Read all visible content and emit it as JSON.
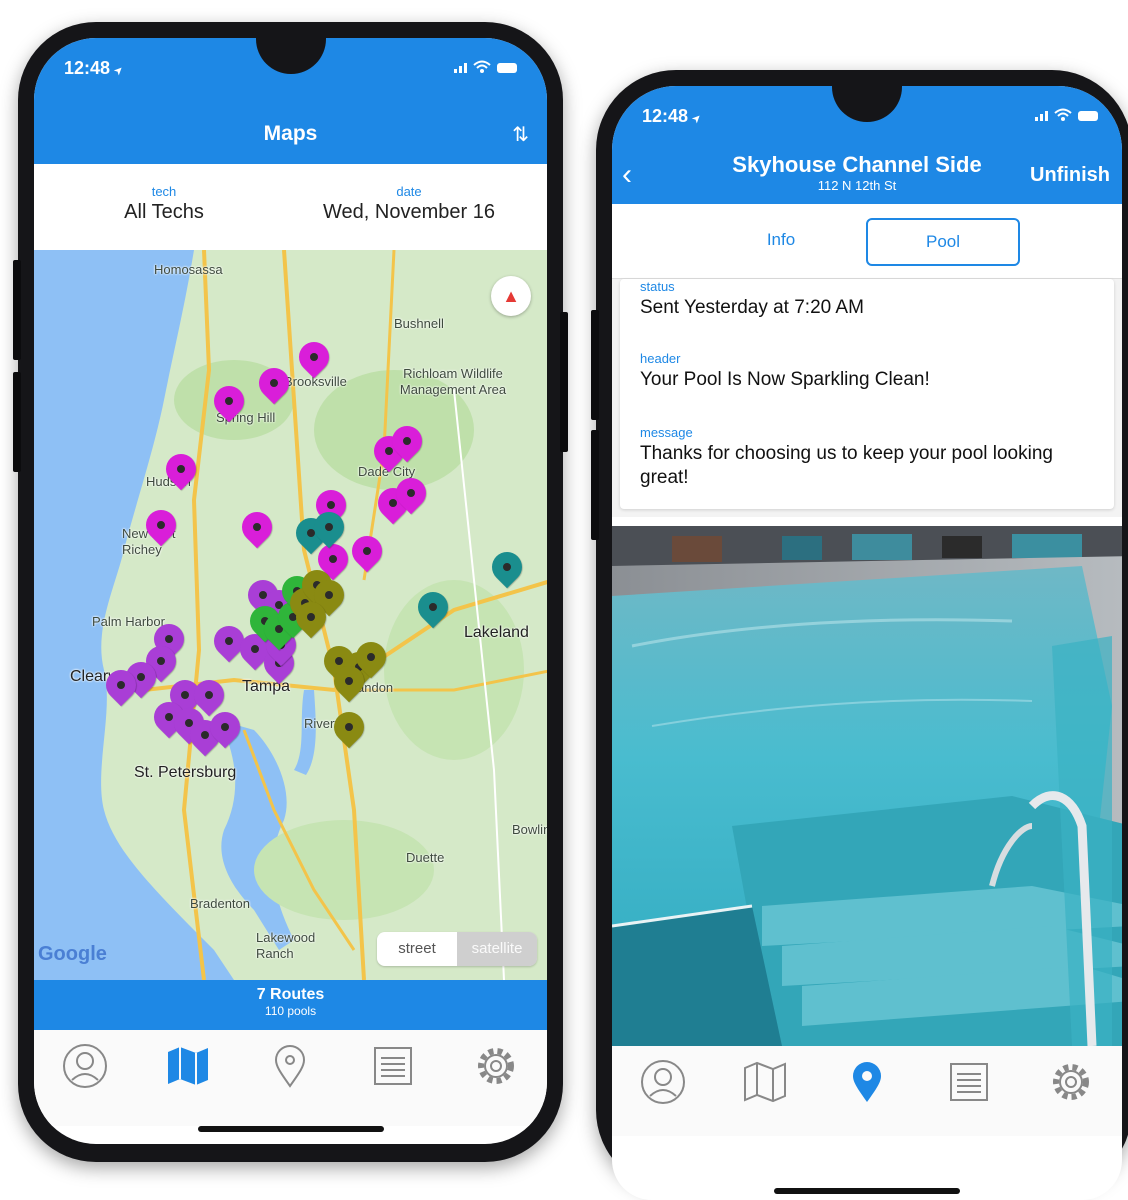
{
  "colors": {
    "accent": "#1e88e5",
    "magenta": "#d91ed9",
    "purple": "#a93ed6",
    "teal": "#1a8e8e",
    "green": "#2fb53a",
    "olive": "#8a8a12"
  },
  "phone_a": {
    "status": {
      "time": "12:48"
    },
    "header": {
      "title": "Maps",
      "sort_icon": "sort-arrows-icon"
    },
    "filters": {
      "tech_label": "tech",
      "tech_value": "All Techs",
      "date_label": "date",
      "date_value": "Wed, November 16"
    },
    "map": {
      "places": [
        "Homosassa",
        "Bushnell",
        "Richloam Wildlife Management Area",
        "Spring Hill",
        "Brooksville",
        "Hudson",
        "New Port Richey",
        "Dade City",
        "Palm Harbor",
        "Clearwater",
        "Tampa",
        "Brandon",
        "Riverview",
        "St. Petersburg",
        "Lakeland",
        "Duette",
        "Bradenton",
        "Lakewood Ranch",
        "Bowling Green"
      ],
      "attribution": "Google",
      "toggle": {
        "street": "street",
        "satellite": "satellite"
      }
    },
    "routes_bar": {
      "routes": "7 Routes",
      "pools": "110 pools"
    },
    "tabs": [
      "profile-icon",
      "map-icon",
      "location-pin-icon",
      "list-icon",
      "settings-icon"
    ]
  },
  "phone_b": {
    "status": {
      "time": "12:48"
    },
    "header": {
      "back": "‹",
      "title": "Skyhouse  Channel Side",
      "subtitle": "112 N 12th St",
      "action": "Unfinish"
    },
    "segments": {
      "info": "Info",
      "pool": "Pool"
    },
    "fields": {
      "status_label": "status",
      "status_value": "Sent Yesterday at 7:20 AM",
      "header_label": "header",
      "header_value": "Your Pool Is Now Sparkling Clean!",
      "message_label": "message",
      "message_value": "Thanks for choosing us to keep your pool looking great!"
    },
    "tabs": [
      "profile-icon",
      "map-icon",
      "location-pin-icon",
      "list-icon",
      "settings-icon"
    ]
  }
}
